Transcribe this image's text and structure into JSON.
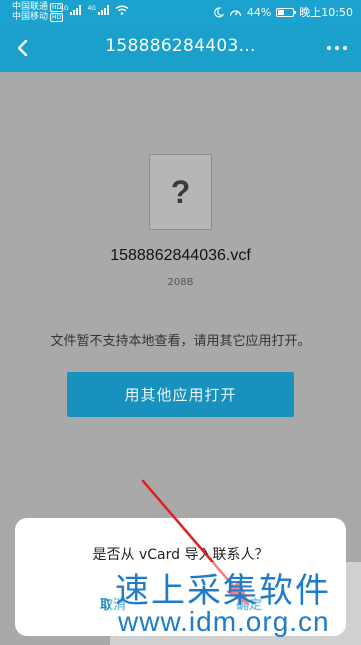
{
  "statusbar": {
    "carrier1": "中国联通",
    "carrier2": "中国移动",
    "hd_label": "HD",
    "network1": "4G",
    "network2": "4G",
    "battery": "44%",
    "battery_level": 0.44,
    "time": "晚上10:50",
    "icons": [
      "moon-icon",
      "speed-gauge-icon",
      "wifi-icon",
      "signal-icon"
    ]
  },
  "header": {
    "title": "158886284403...",
    "back_icon": "chevron-left-icon",
    "more_icon": "more-dots-icon"
  },
  "file": {
    "icon_glyph": "?",
    "name": "1588862844036.vcf",
    "size": "208B"
  },
  "hint": "文件暂不支持本地查看，请用其它应用打开。",
  "open_button": "用其他应用打开",
  "dialog": {
    "message": "是否从 vCard 导入联系人？",
    "cancel": "取消",
    "confirm": "确定"
  },
  "watermark": {
    "line1": "速上采集软件",
    "line2": "www.idm.org.cn"
  },
  "colors": {
    "header": "#1aa0cb",
    "button": "#1991bf",
    "dialog_action": "#1a8fc0",
    "annotation_arrow": "#e02020",
    "watermark": "#1f7cc8"
  }
}
